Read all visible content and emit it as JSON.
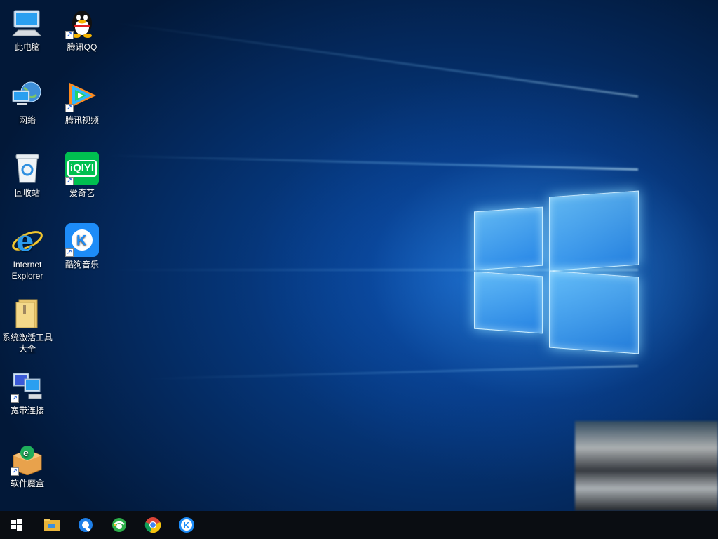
{
  "desktop": {
    "icons": [
      {
        "label": "此电脑",
        "icon": "this-pc-icon"
      },
      {
        "label": "腾讯QQ",
        "icon": "qq-icon"
      },
      {
        "label": "网络",
        "icon": "network-icon"
      },
      {
        "label": "腾讯视频",
        "icon": "tencent-video-icon"
      },
      {
        "label": "回收站",
        "icon": "recycle-bin-icon"
      },
      {
        "label": "爱奇艺",
        "icon": "iqiyi-icon",
        "logo_text": "iQIYI"
      },
      {
        "label": "Internet Explorer",
        "icon": "internet-explorer-icon"
      },
      {
        "label": "酷狗音乐",
        "icon": "kugou-music-icon"
      },
      {
        "label": "系统激活工具大全",
        "icon": "folder-icon"
      },
      {
        "label": "宽带连接",
        "icon": "broadband-connection-icon"
      },
      {
        "label": "软件魔盒",
        "icon": "software-box-icon"
      }
    ]
  },
  "taskbar": {
    "items": [
      {
        "icon": "windows-start-icon"
      },
      {
        "icon": "file-explorer-icon"
      },
      {
        "icon": "browser-q-icon"
      },
      {
        "icon": "360-browser-icon"
      },
      {
        "icon": "chrome-icon"
      },
      {
        "icon": "kugou-icon"
      }
    ]
  },
  "colors": {
    "taskbar": "#0a0d12",
    "wallpaper_blue": "#063a82",
    "iqiyi_green": "#00c050",
    "kugou_blue": "#1d8cf8"
  }
}
